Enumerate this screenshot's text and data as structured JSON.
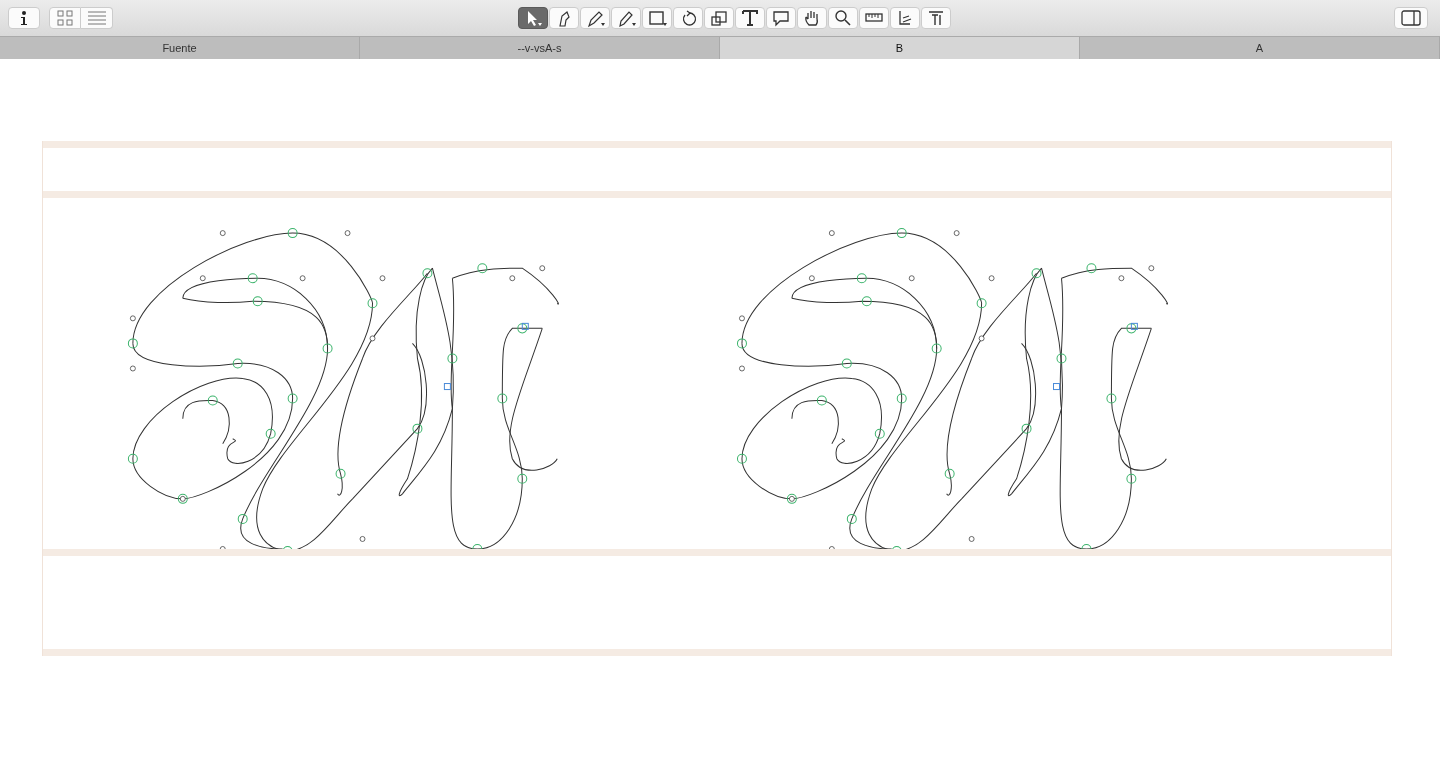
{
  "toolbar": {
    "tools": [
      {
        "kind": "select",
        "selected": true
      },
      {
        "kind": "nib",
        "selected": false
      },
      {
        "kind": "pen",
        "selected": false
      },
      {
        "kind": "pencil",
        "selected": false
      },
      {
        "kind": "rectangle",
        "selected": false
      },
      {
        "kind": "rotate",
        "selected": false
      },
      {
        "kind": "scale",
        "selected": false
      },
      {
        "kind": "text",
        "selected": false
      },
      {
        "kind": "comment",
        "selected": false
      },
      {
        "kind": "hand",
        "selected": false
      },
      {
        "kind": "zoom",
        "selected": false
      },
      {
        "kind": "ruler",
        "selected": false
      },
      {
        "kind": "stem",
        "selected": false
      },
      {
        "kind": "type",
        "selected": false
      }
    ]
  },
  "tabs": [
    {
      "label": "Fuente",
      "selected": false
    },
    {
      "label": "--v-vsA-s",
      "selected": false
    },
    {
      "label": "B",
      "selected": true
    },
    {
      "label": "A",
      "selected": false
    }
  ]
}
